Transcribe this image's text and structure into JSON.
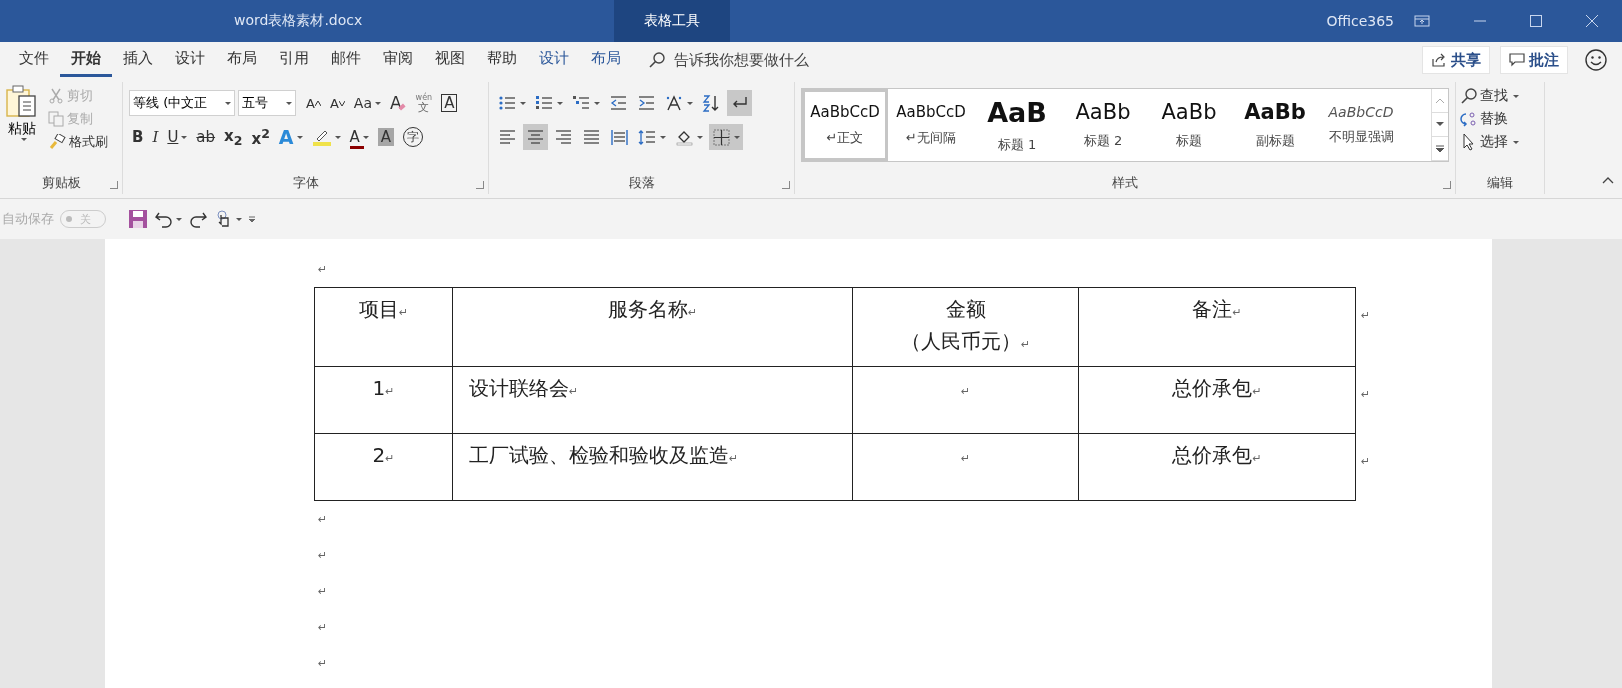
{
  "title_bar": {
    "document_title": "word表格素材.docx",
    "context_tab": "表格工具",
    "account": "Office365"
  },
  "ribbon_tabs": [
    {
      "label": "文件",
      "selected": false,
      "kind": "normal"
    },
    {
      "label": "开始",
      "selected": true,
      "kind": "normal"
    },
    {
      "label": "插入",
      "selected": false,
      "kind": "normal"
    },
    {
      "label": "设计",
      "selected": false,
      "kind": "normal"
    },
    {
      "label": "布局",
      "selected": false,
      "kind": "normal"
    },
    {
      "label": "引用",
      "selected": false,
      "kind": "normal"
    },
    {
      "label": "邮件",
      "selected": false,
      "kind": "normal"
    },
    {
      "label": "审阅",
      "selected": false,
      "kind": "normal"
    },
    {
      "label": "视图",
      "selected": false,
      "kind": "normal"
    },
    {
      "label": "帮助",
      "selected": false,
      "kind": "normal"
    },
    {
      "label": "设计",
      "selected": false,
      "kind": "context"
    },
    {
      "label": "布局",
      "selected": false,
      "kind": "context"
    }
  ],
  "tell_me": {
    "placeholder": "告诉我你想要做什么"
  },
  "share_button": "共享",
  "comments_button": "批注",
  "clipboard": {
    "label": "剪贴板",
    "paste": "粘贴",
    "items": [
      {
        "kind": "cut",
        "label": "剪切",
        "disabled": true
      },
      {
        "kind": "copy",
        "label": "复制",
        "disabled": true
      },
      {
        "kind": "painter",
        "label": "格式刷",
        "disabled": false
      }
    ]
  },
  "font": {
    "label": "字体",
    "font_name": "等线 (中文正",
    "font_size": "五号",
    "row1": [
      {
        "kind": "grow",
        "label": "A"
      },
      {
        "kind": "shrink",
        "label": "A"
      },
      {
        "kind": "case",
        "label": "Aa",
        "dropdown": true
      },
      {
        "kind": "clear",
        "label": "A"
      },
      {
        "kind": "phonetic",
        "label": "文",
        "ruby": "wén"
      },
      {
        "kind": "border",
        "label": "A"
      }
    ],
    "row2": [
      {
        "kind": "bold",
        "label": "B"
      },
      {
        "kind": "italic",
        "label": "I"
      },
      {
        "kind": "underline",
        "label": "U",
        "dropdown": true
      },
      {
        "kind": "strike",
        "label": "ab"
      },
      {
        "kind": "sub",
        "label": "x$_{2}$"
      },
      {
        "kind": "sup",
        "label": "x$^{2}$"
      },
      {
        "kind": "effects",
        "label": "A",
        "dropdown": true
      },
      {
        "kind": "highlight",
        "dropdown": true
      },
      {
        "kind": "color",
        "label": "A",
        "dropdown": true
      },
      {
        "kind": "shading",
        "label": "A"
      },
      {
        "kind": "enclose",
        "label": "字"
      }
    ]
  },
  "paragraph": {
    "label": "段落",
    "row1": [
      {
        "kind": "bullets",
        "selected": false,
        "dropdown": true
      },
      {
        "kind": "numbering",
        "selected": false,
        "dropdown": true
      },
      {
        "kind": "multilevel",
        "selected": false,
        "dropdown": true
      },
      {
        "kind": "outdent",
        "selected": false
      },
      {
        "kind": "indent",
        "selected": false
      },
      {
        "kind": "asian",
        "selected": false,
        "dropdown": true
      },
      {
        "kind": "sort",
        "selected": false
      },
      {
        "kind": "marks",
        "selected": true
      }
    ],
    "row2": [
      {
        "kind": "left",
        "selected": false
      },
      {
        "kind": "center",
        "selected": true
      },
      {
        "kind": "right",
        "selected": false
      },
      {
        "kind": "justify",
        "selected": false
      },
      {
        "kind": "distribute",
        "selected": false
      },
      {
        "kind": "spacing",
        "selected": false,
        "dropdown": true
      },
      {
        "kind": "fill",
        "selected": false,
        "dropdown": true
      },
      {
        "kind": "borders",
        "selected": true,
        "dropdown": true
      }
    ]
  },
  "styles": {
    "label": "样式",
    "items": [
      {
        "kind": "normal",
        "preview": "AaBbCcD",
        "name": "↵正文",
        "selected": true
      },
      {
        "kind": "normal",
        "preview": "AaBbCcD",
        "name": "↵无间隔",
        "selected": false
      },
      {
        "kind": "heading1",
        "preview": "AaB",
        "name": "标题 1",
        "selected": false
      },
      {
        "kind": "heading2",
        "preview": "AaBb",
        "name": "标题 2",
        "selected": false
      },
      {
        "kind": "title",
        "preview": "AaBb",
        "name": "标题",
        "selected": false
      },
      {
        "kind": "subtitle",
        "preview": "AaBb",
        "name": "副标题",
        "selected": false
      },
      {
        "kind": "emphasis",
        "preview": "AaBbCcD",
        "name": "不明显强调",
        "selected": false
      }
    ]
  },
  "editing": {
    "label": "编辑",
    "items": [
      {
        "kind": "find",
        "label": "查找",
        "dropdown": true
      },
      {
        "kind": "replace",
        "label": "替换",
        "dropdown": false
      },
      {
        "kind": "select",
        "label": "选择",
        "dropdown": true
      }
    ]
  },
  "quick_access": {
    "autosave_label": "自动保存",
    "autosave_state": "关",
    "autosave_on": false
  },
  "document": {
    "mark": "↵",
    "paragraphs_before": [
      "↵"
    ],
    "paragraphs_after": [
      "↵",
      "↵",
      "↵",
      "↵",
      "↵"
    ],
    "table": {
      "rows": [
        {
          "cells": [
            {
              "lines": [
                "项目"
              ]
            },
            {
              "lines": [
                "服务名称"
              ]
            },
            {
              "lines": [
                "金额",
                "（人民币元）"
              ]
            },
            {
              "lines": [
                "备注"
              ]
            }
          ]
        },
        {
          "cells": [
            {
              "lines": [
                "1"
              ]
            },
            {
              "lines": [
                "设计联络会"
              ]
            },
            {},
            {
              "lines": [
                "总价承包"
              ]
            }
          ]
        },
        {
          "cells": [
            {
              "lines": [
                "2"
              ]
            },
            {
              "lines": [
                "工厂试验、检验和验收及监造"
              ]
            },
            {},
            {
              "lines": [
                "总价承包"
              ]
            }
          ]
        }
      ]
    }
  }
}
